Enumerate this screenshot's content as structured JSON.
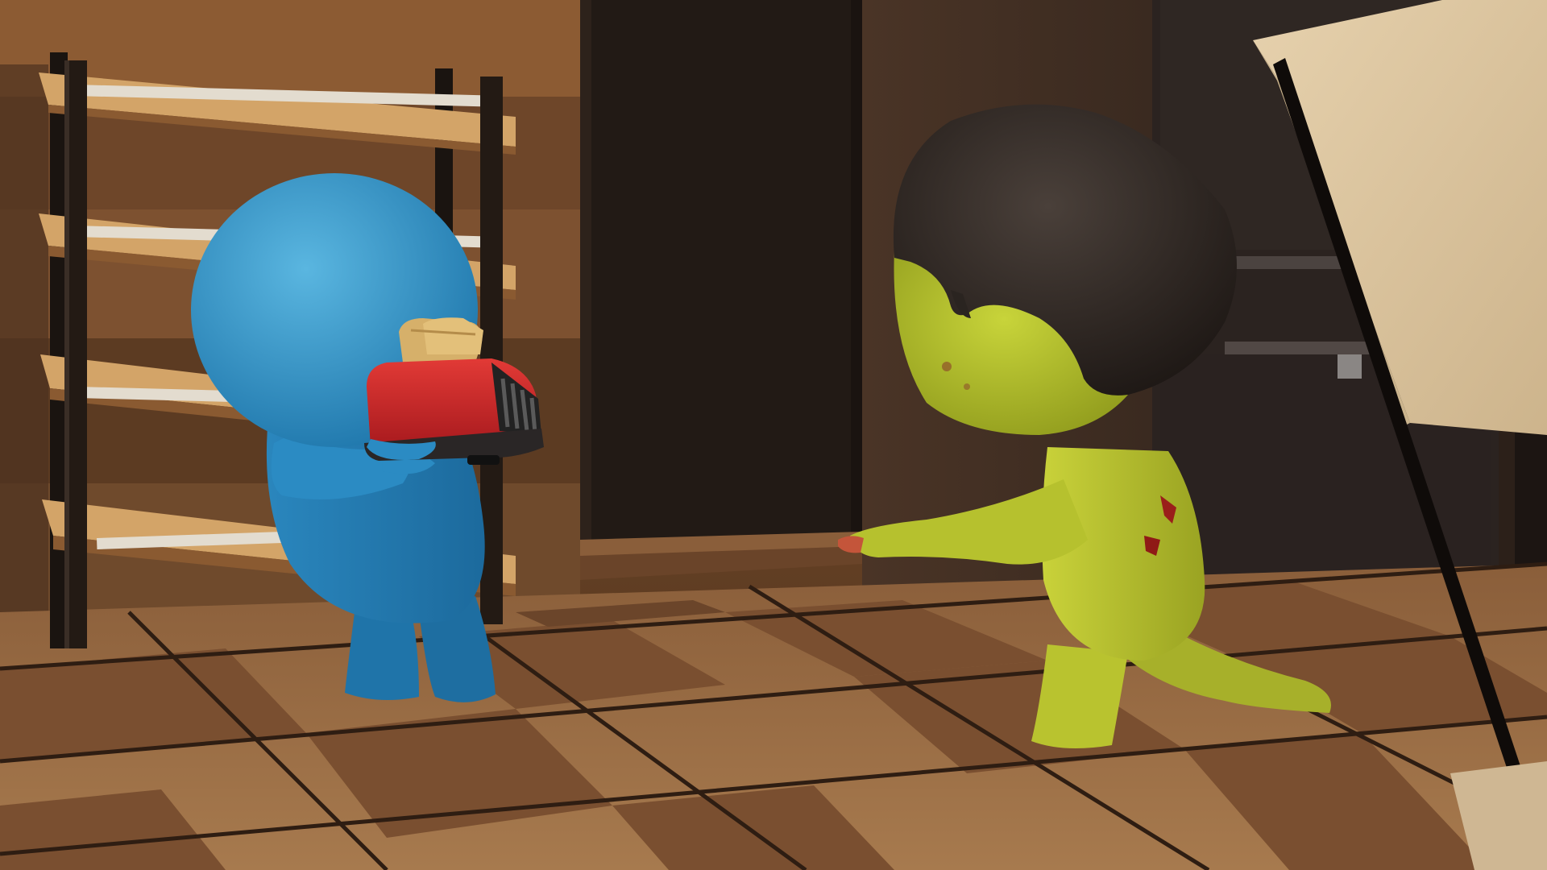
{
  "scene": {
    "kind": "3D rendered game scene",
    "setting": "kitchen",
    "characters": [
      {
        "role": "player",
        "color": "#2f8fc4",
        "holding": "toaster"
      },
      {
        "role": "zombie",
        "skin_color": "#b5c22a",
        "hair_color": "#2a2420"
      }
    ],
    "props": [
      "wooden-shelf",
      "red-toaster",
      "toast-slices",
      "dark-doorway",
      "refrigerator",
      "counter-corner"
    ],
    "palette": {
      "wall_light": "#7a4e2c",
      "wall_dark": "#3c2a1f",
      "floor_light": "#b98a5a",
      "floor_dark": "#7a4f30",
      "grout": "#2e1d12",
      "doorway": "#221a15",
      "toaster_red": "#c8262a",
      "toast": "#d6b06a"
    }
  }
}
